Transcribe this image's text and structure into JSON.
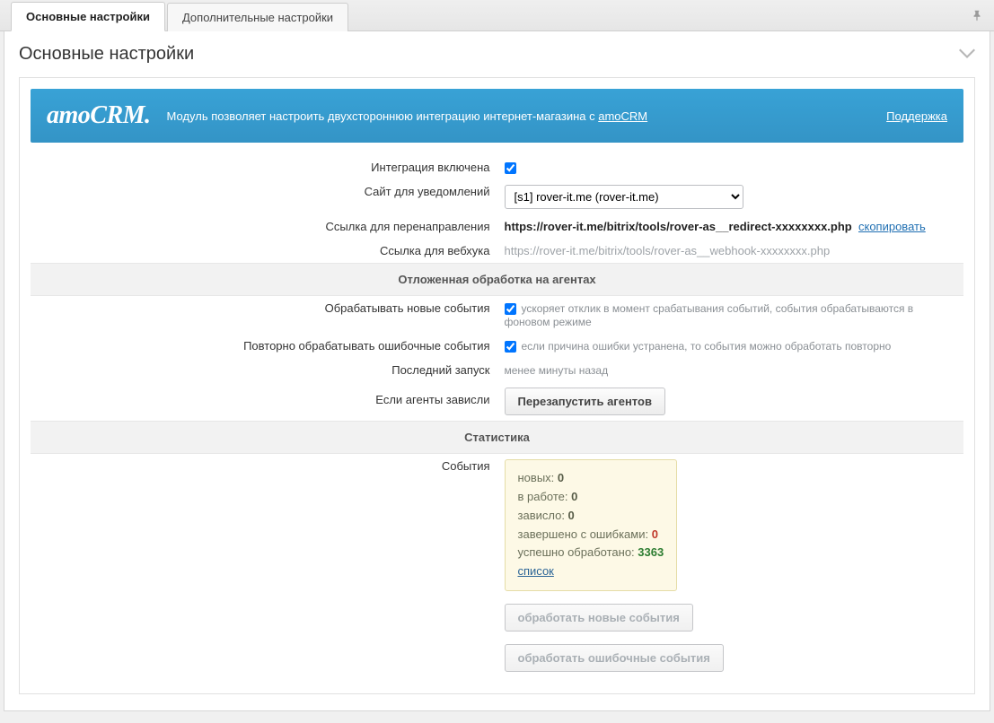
{
  "tabs": {
    "main": "Основные настройки",
    "extra": "Дополнительные настройки"
  },
  "section_title": "Основные настройки",
  "banner": {
    "logo_a": "amo",
    "logo_b": "CRM",
    "logo_dot": ".",
    "text_before": "Модуль позволяет настроить двухстороннюю интеграцию интернет-магазина с ",
    "link": "amoCRM",
    "support": "Поддержка"
  },
  "rows": {
    "integration_enabled": {
      "label": "Интеграция включена"
    },
    "notify_site": {
      "label": "Сайт для уведомлений",
      "value": "[s1] rover-it.me (rover-it.me)"
    },
    "redirect": {
      "label": "Ссылка для перенаправления",
      "url": "https://rover-it.me/bitrix/tools/rover-as__redirect-xxxxxxxx.php",
      "copy": "скопировать"
    },
    "webhook": {
      "label": "Ссылка для вебхука",
      "url": "https://rover-it.me/bitrix/tools/rover-as__webhook-xxxxxxxx.php"
    }
  },
  "agents": {
    "header": "Отложенная обработка на агентах",
    "process_new": {
      "label": "Обрабатывать новые события",
      "hint": "ускоряет отклик в момент срабатывания событий, события обрабатываются в фоновом режиме"
    },
    "retry_failed": {
      "label": "Повторно обрабатывать ошибочные события",
      "hint": "если причина ошибки устранена, то события можно обработать повторно"
    },
    "last_run": {
      "label": "Последний запуск",
      "value": "менее минуты назад"
    },
    "if_hung": {
      "label": "Если агенты зависли",
      "button": "Перезапустить агентов"
    }
  },
  "stats": {
    "header": "Статистика",
    "events_label": "События",
    "new_label": "новых: ",
    "new_value": "0",
    "in_work_label": "в работе: ",
    "in_work_value": "0",
    "hung_label": "зависло: ",
    "hung_value": "0",
    "failed_label": "завершено с ошибками: ",
    "failed_value": "0",
    "success_label": "успешно обработано: ",
    "success_value": "3363",
    "list_link": "список",
    "btn_process_new": "обработать новые события",
    "btn_process_failed": "обработать ошибочные события"
  }
}
